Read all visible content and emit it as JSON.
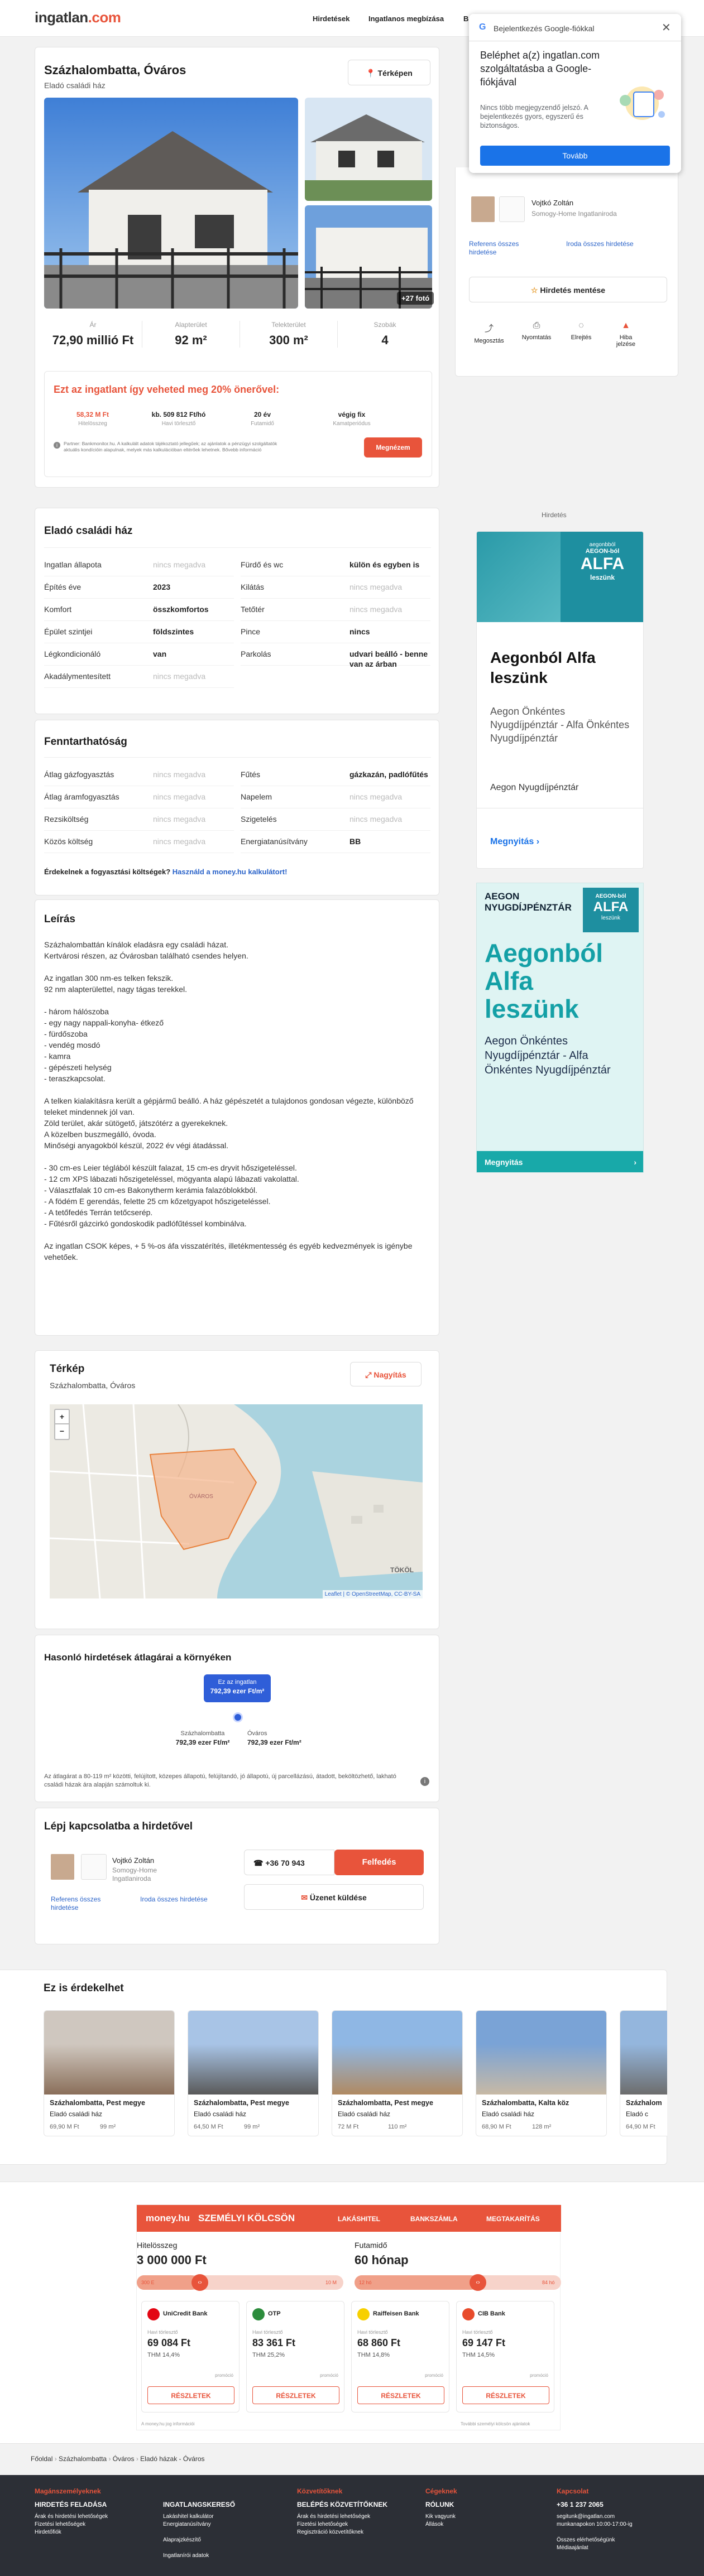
{
  "header": {
    "logo_main": "ingatlan",
    "logo_suffix": ".com",
    "nav": [
      "Hirdetések",
      "Ingatlanos megbízása",
      "Bu"
    ]
  },
  "google_popup": {
    "title": "Bejelentkezés Google-fiókkal",
    "heading": "Beléphet a(z) ingatlan.com szolgáltatásba a Google-fiókjával",
    "body": "Nincs több megjegyzendő jelszó. A bejelentkezés gyors, egyszerű és biztonságos.",
    "button": "Tovább"
  },
  "listing": {
    "title": "Százhalombatta, Óváros",
    "subtitle": "Eladó családi ház",
    "map_button": "Térképen",
    "photo_count": "+27 fotó",
    "stats": [
      {
        "label": "Ár",
        "value": "72,90 millió Ft"
      },
      {
        "label": "Alapterület",
        "value": "92 m²"
      },
      {
        "label": "Telekterület",
        "value": "300 m²"
      },
      {
        "label": "Szobák",
        "value": "4"
      }
    ]
  },
  "csok": {
    "title": "Ezt az ingatlant így veheted meg 20% önerővel:",
    "items": [
      {
        "value": "58,32 M Ft",
        "label": "Hitelösszeg"
      },
      {
        "value": "kb. 509 812 Ft/hó",
        "label": "Havi törlesztő"
      },
      {
        "value": "20 év",
        "label": "Futamidő"
      },
      {
        "value": "végig fix",
        "label": "Kamatperiódus"
      }
    ],
    "note": "Partner: Bankmonitor.hu. A kalkulált adatok tájékoztató jellegűek; az ajánlatok a pénzügyi szolgáltatók aktuális kondícióin alapulnak, melyek más kalkulációban eltérőek lehetnek. Bővebb információ",
    "button": "Megnézem"
  },
  "agent": {
    "name": "Vojtkó Zoltán",
    "office": "Somogy-Home Ingatlaniroda",
    "link1": "Referens összes hirdetése",
    "link2": "Iroda összes hirdetése",
    "save": "Hirdetés mentése",
    "actions": [
      "Megosztás",
      "Nyomtatás",
      "Elrejtés",
      "Hiba jelzése"
    ]
  },
  "ad_label": "Hirdetés",
  "ad1": {
    "brand": "aegonbból",
    "brand2": "AEGON-ból",
    "big": "ALFA",
    "small": "leszünk",
    "headline": "Aegonból Alfa leszünk",
    "sub": "Aegon Önkéntes Nyugdíjpénztár - Alfa Önkéntes Nyugdíjpénztár",
    "source": "Aegon Nyugdíjpénztár",
    "cta": "Megnyitás"
  },
  "ad2": {
    "top": "AEGON NYUGDÍJPÉNZTÁR",
    "badge1": "AEGON-ból",
    "badge2": "ALFA",
    "badge3": "leszünk",
    "headline": "Aegonból Alfa leszünk",
    "sub": "Aegon Önkéntes Nyugdíjpénztár - Alfa Önkéntes Nyugdíjpénztár",
    "cta": "Megnyitás"
  },
  "details": {
    "title": "Eladó családi ház",
    "left": [
      {
        "k": "Ingatlan állapota",
        "v": "nincs megadva",
        "na": true
      },
      {
        "k": "Építés éve",
        "v": "2023"
      },
      {
        "k": "Komfort",
        "v": "összkomfortos"
      },
      {
        "k": "Épület szintjei",
        "v": "földszintes"
      },
      {
        "k": "Légkondicionáló",
        "v": "van"
      },
      {
        "k": "Akadálymentesített",
        "v": "nincs megadva",
        "na": true
      }
    ],
    "right": [
      {
        "k": "Fürdő és wc",
        "v": "külön és egyben is"
      },
      {
        "k": "Kilátás",
        "v": "nincs megadva",
        "na": true
      },
      {
        "k": "Tetőtér",
        "v": "nincs megadva",
        "na": true
      },
      {
        "k": "Pince",
        "v": "nincs"
      },
      {
        "k": "Parkolás",
        "v": "udvari beálló - benne van az árban"
      }
    ]
  },
  "sustain": {
    "title": "Fenntarthatóság",
    "left": [
      {
        "k": "Átlag gázfogyasztás",
        "v": "nincs megadva",
        "na": true
      },
      {
        "k": "Átlag áramfogyasztás",
        "v": "nincs megadva",
        "na": true
      },
      {
        "k": "Rezsiköltség",
        "v": "nincs megadva",
        "na": true
      },
      {
        "k": "Közös költség",
        "v": "nincs megadva",
        "na": true
      }
    ],
    "right": [
      {
        "k": "Fűtés",
        "v": "gázkazán, padlófűtés"
      },
      {
        "k": "Napelem",
        "v": "nincs megadva",
        "na": true
      },
      {
        "k": "Szigetelés",
        "v": "nincs megadva",
        "na": true
      },
      {
        "k": "Energiatanúsítvány",
        "v": "BB"
      }
    ],
    "q": "Érdekelnek a fogyasztási költségek?",
    "link": "Használd a money.hu kalkulátort!"
  },
  "desc": {
    "title": "Leírás",
    "lines": [
      "Százhalombattán kínálok eladásra egy családi házat.",
      "Kertvárosi részen, az Óvárosban található csendes helyen.",
      "",
      "Az ingatlan 300 nm-es telken fekszik.",
      "92 nm alapterülettel, nagy tágas terekkel.",
      "",
      "- három hálószoba",
      "- egy nagy nappali-konyha- étkező",
      "- fürdőszoba",
      "- vendég mosdó",
      "- kamra",
      "- gépészeti helység",
      "- teraszkapcsolat.",
      "",
      "A telken  kialakításra került a gépjármű beálló. A ház gépészetét a tulajdonos gondosan végezte, különböző teleket mindennek jól van.",
      "Zöld terület, akár sütögető, játszótérz a gyerekeknek.",
      "A közelben buszmegálló, óvoda.",
      "Minőségi anyagokból készül, 2022 év végi átadással.",
      "",
      "- 30 cm-es Leier téglából készült falazat, 15 cm-es dryvit hőszigeteléssel.",
      "- 12 cm XPS lábazati hőszigeteléssel, mögyanta alapú lábazati vakolattal.",
      "- Választfalak 10 cm-es Bakonytherm kerámia falazóblokkból.",
      "- A födém E gerendás, felette 25 cm kőzetgyapot hőszigeteléssel.",
      "- A tetőfedés Terrán tetőcserép.",
      "- Fűtésről gázcirkó gondoskodik padlófűtéssel kombinálva.",
      "",
      "Az ingatlan CSOK képes, + 5 %-os áfa visszatérítés, illetékmentesség és egyéb kedvezmények is igénybe vehetőek."
    ]
  },
  "map": {
    "title": "Térkép",
    "subtitle": "Százhalombatta, Óváros",
    "button": "Nagyítás",
    "attribution": "Leaflet | © OpenStreetMap, CC-BY-SA",
    "town1": "TÖKÖL",
    "area": "ÓVÁROS"
  },
  "similar": {
    "title": "Hasonló hirdetések átlagárai a környéken",
    "bubble1": "Ez az ingatlan",
    "bubble2": "792,39 ezer Ft/m²",
    "c1": "Százhalombatta",
    "c1v": "792,39 ezer Ft/m²",
    "c2": "Óváros",
    "c2v": "792,39 ezer Ft/m²",
    "note": "Az átlagárat a 80-119 m² közötti, felújított, közepes állapotú, felújítandó, jó állapotú, új parcellázású, átadott, beköltözhető, lakható családi házak ára alapján számoltuk ki."
  },
  "contact": {
    "title": "Lépj kapcsolatba a hirdetővel",
    "phone": "+36 70 943",
    "reveal": "Felfedés",
    "message": "Üzenet küldése"
  },
  "recommend": {
    "title": "Ez is érdekelhet",
    "cards": [
      {
        "t": "Százhalombatta, Pest megye",
        "s": "Eladó családi ház",
        "p": "69,90 M Ft",
        "a": "99 m²"
      },
      {
        "t": "Százhalombatta, Pest megye",
        "s": "Eladó családi ház",
        "p": "64,50 M Ft",
        "a": "99 m²"
      },
      {
        "t": "Százhalombatta, Pest megye",
        "s": "Eladó családi ház",
        "p": "72 M Ft",
        "a": "110 m²"
      },
      {
        "t": "Százhalombatta, Kalta köz",
        "s": "Eladó családi ház",
        "p": "68,90 M Ft",
        "a": "128 m²"
      },
      {
        "t": "Százhalom",
        "s": "Eladó c",
        "p": "64,90 M Ft",
        "a": ""
      }
    ]
  },
  "money": {
    "logo": "money.hu",
    "title": "SZEMÉLYI KÖLCSÖN",
    "tabs": [
      "LAKÁSHITEL",
      "BANKSZÁMLA",
      "MEGTAKARÍTÁS"
    ],
    "amount_label": "Hitelösszeg",
    "amount": "3 000 000 Ft",
    "term_label": "Futamidő",
    "term": "60 hónap",
    "min1": "300 E",
    "max1": "10 M",
    "min2": "12 hó",
    "max2": "84 hó",
    "banks": [
      {
        "n": "UniCredit Bank",
        "m": "69 084 Ft",
        "t": "THM 14,4%"
      },
      {
        "n": "OTP",
        "m": "83 361 Ft",
        "t": "THM 25,2%"
      },
      {
        "n": "Raiffeisen Bank",
        "m": "68 860 Ft",
        "t": "THM 14,8%"
      },
      {
        "n": "CIB Bank",
        "m": "69 147 Ft",
        "t": "THM 14,5%"
      }
    ],
    "rata": "Havi törlesztő",
    "promo": "promóció",
    "details": "RÉSZLETEK",
    "foot1": "A money.hu jog információi",
    "foot2": "További személyi kölcsön ajánlatok"
  },
  "breadcrumb": [
    "Főoldal",
    "Százhalombatta",
    "Óváros",
    "Eladó házak - Óváros"
  ],
  "footer": {
    "cols": [
      {
        "h": "Magánszemélyeknek",
        "i": [
          "HIRDETÉS FELADÁSA",
          "Árak és hirdetési lehetőségek",
          "Fizetési lehetőségek",
          "Hirdetőfiók"
        ]
      },
      {
        "h": "",
        "i": [
          "INGATLANGSKERESŐ",
          "Lakáshitel kalkulátor",
          "Energiatanúsítvány",
          "",
          "Alaprajzkészítő",
          "",
          "Ingatlanírói adatok"
        ]
      },
      {
        "h": "Közvetítőknek",
        "i": [
          "BELÉPÉS KÖZVETÍTŐKNEK",
          "Árak és hirdetési lehetőségek",
          "Fizetési lehetőségek",
          "Regisztráció közvetítőknek"
        ]
      },
      {
        "h": "Cégeknek",
        "i": [
          "RÓLUNK",
          "Kik vagyunk",
          "Állások"
        ]
      },
      {
        "h": "Kapcsolat",
        "i": [
          "+36 1 237 2065",
          "segitunk@ingatlan.com",
          "munkanapokon 10:00-17:00-ig",
          "",
          "Összes elérhetőségünk",
          "Médiaajánlat"
        ]
      }
    ]
  }
}
